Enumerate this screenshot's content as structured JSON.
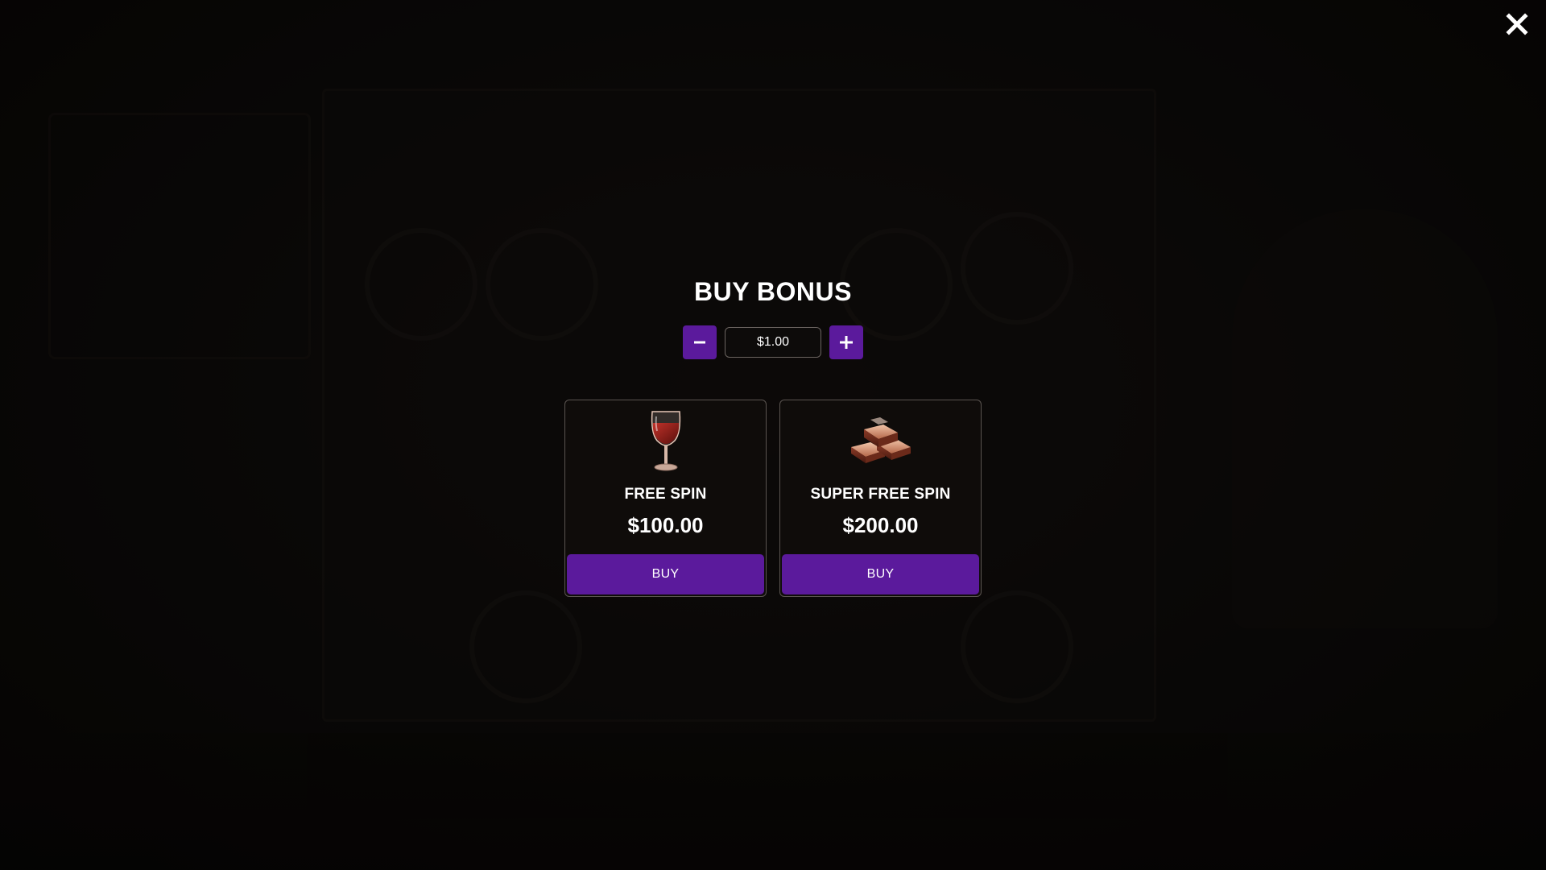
{
  "modal": {
    "title": "BUY BONUS",
    "bet": {
      "value": "$1.00",
      "decrease_icon": "minus-icon",
      "increase_icon": "plus-icon"
    },
    "options": [
      {
        "name": "FREE SPIN",
        "price": "$100.00",
        "button_label": "BUY",
        "icon": "wine-glass-icon"
      },
      {
        "name": "SUPER FREE SPIN",
        "price": "$200.00",
        "button_label": "BUY",
        "icon": "gold-bars-icon"
      }
    ]
  },
  "close_icon": "close-icon",
  "colors": {
    "accent": "#5b1a9c",
    "text": "#ffffff",
    "background": "#0b0908",
    "card_border": "#5a5450"
  }
}
